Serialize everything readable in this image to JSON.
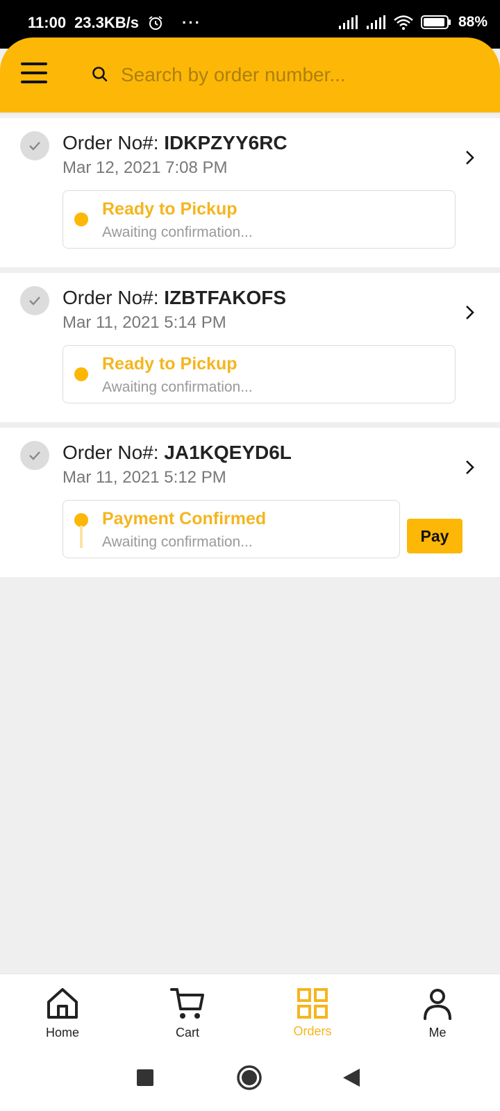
{
  "status_bar": {
    "time": "11:00",
    "speed": "23.3KB/s",
    "dots": "···",
    "battery": "88%"
  },
  "search": {
    "placeholder": "Search by order number..."
  },
  "orders": [
    {
      "label": "Order No#:",
      "number": "IDKPZYY6RC",
      "date": "Mar 12, 2021 7:08 PM",
      "status": "Ready to Pickup",
      "substatus": "Awaiting confirmation..."
    },
    {
      "label": "Order No#:",
      "number": "IZBTFAKOFS",
      "date": "Mar 11, 2021 5:14 PM",
      "status": "Ready to Pickup",
      "substatus": "Awaiting confirmation..."
    },
    {
      "label": "Order No#:",
      "number": "JA1KQEYD6L",
      "date": "Mar 11, 2021 5:12 PM",
      "status": "Payment Confirmed",
      "substatus": "Awaiting confirmation...",
      "action": "Pay"
    }
  ],
  "nav": {
    "home": "Home",
    "cart": "Cart",
    "orders": "Orders",
    "me": "Me",
    "active": "orders"
  },
  "colors": {
    "accent": "#FDB706",
    "status_text": "#F5B51F",
    "background": "#EFEFEF"
  }
}
